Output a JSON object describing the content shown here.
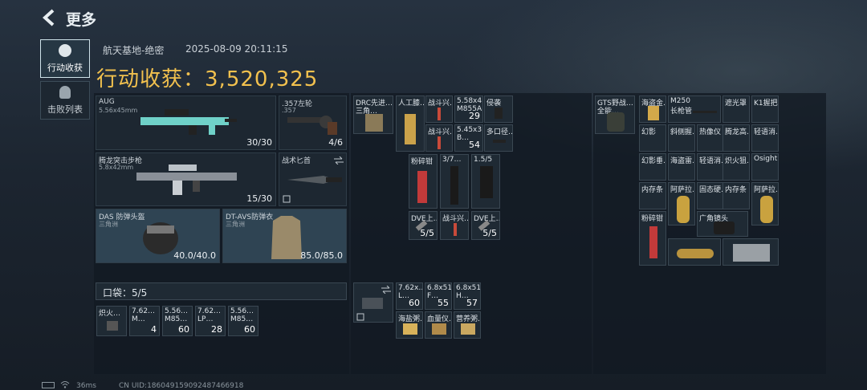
{
  "header": {
    "title": "更多",
    "back_icon": "back-arrow-icon"
  },
  "sidebar": {
    "tabs": [
      {
        "label": "行动收获",
        "icon": "harvest-icon"
      },
      {
        "label": "击败列表",
        "icon": "skull-icon"
      }
    ]
  },
  "match": {
    "map": "航天基地-绝密",
    "time": "2025-08-09 20:11:15"
  },
  "harvest": {
    "label": "行动收获：",
    "value": "3,520,325"
  },
  "weapons": {
    "primary1": {
      "name": "AUG",
      "sub": "5.56x45mm",
      "ammo": "30/30"
    },
    "pistol": {
      "name": ".357左轮",
      "sub": ".357",
      "ammo": "4/6"
    },
    "primary2": {
      "name": "腾龙突击步枪",
      "sub": "5.8x42mm",
      "ammo": "15/30"
    },
    "knife": {
      "name": "战术匕首"
    },
    "helmet": {
      "name": "DAS 防弹头盔",
      "sub": "三角洲",
      "dur": "40.0/40.0"
    },
    "armor": {
      "name": "DT-AVS防弹衣",
      "sub": "三角洲",
      "dur": "85.0/85.0"
    }
  },
  "pocket": {
    "label": "口袋：5/5",
    "items": [
      {
        "name": "炽火…",
        "count": ""
      },
      {
        "name": "7.62…",
        "sub": "M…",
        "count": "4"
      },
      {
        "name": "5.56…",
        "sub": "M85…",
        "count": "60"
      },
      {
        "name": "7.62…",
        "sub": "LP…",
        "count": "28"
      },
      {
        "name": "5.56…",
        "sub": "M85…",
        "count": "60"
      }
    ]
  },
  "rig": {
    "items": [
      {
        "name": "DRC先进…",
        "sub": "三角…"
      },
      {
        "name": "人工膝…"
      },
      {
        "name": "战斗兴…"
      },
      {
        "name": "5.58x4…",
        "sub": "M855A…",
        "count": "29"
      },
      {
        "name": "侵袭"
      },
      {
        "name": "战斗兴…"
      },
      {
        "name": "5.45x3…",
        "sub": "B…",
        "count": "54"
      },
      {
        "name": "多口径…"
      },
      {
        "name": "粉碎钳"
      },
      {
        "name": "3/7…"
      },
      {
        "name": "1.5/5"
      },
      {
        "name": "DVE上…",
        "count": "5/5"
      },
      {
        "name": "战斗兴…"
      },
      {
        "name": "DVE上…",
        "count": "5/5"
      }
    ]
  },
  "bag": {
    "items": [
      {
        "name": "7.62x…",
        "sub": "L…",
        "count": "60"
      },
      {
        "name": "6.8x51…",
        "sub": "F…",
        "count": "55"
      },
      {
        "name": "6.8x51…",
        "sub": "H…",
        "count": "57"
      },
      {
        "name": "海盐粥…"
      },
      {
        "name": "血量仪…"
      },
      {
        "name": "营养粥…"
      }
    ]
  },
  "backpack": {
    "name": "GTS野战…",
    "sub": "全能…",
    "items": [
      {
        "name": "海盗金…"
      },
      {
        "name": "M250",
        "sub": "长枪管"
      },
      {
        "name": "遮光罩"
      },
      {
        "name": "K1握把"
      },
      {
        "name": "幻影"
      },
      {
        "name": "斜侧握…"
      },
      {
        "name": "热像仪"
      },
      {
        "name": "腾龙高…"
      },
      {
        "name": "轻语消…"
      },
      {
        "name": "幻影垂…"
      },
      {
        "name": "海盗雷…"
      },
      {
        "name": "轻语消…"
      },
      {
        "name": "炽火狙…"
      },
      {
        "name": "Osight"
      },
      {
        "name": "内存条"
      },
      {
        "name": "阿萨拉…"
      },
      {
        "name": "固态硬…"
      },
      {
        "name": "内存条"
      },
      {
        "name": "阿萨拉…"
      },
      {
        "name": "粉碎钳"
      },
      {
        "name": "广角镜头"
      }
    ]
  },
  "status": {
    "ping": "36ms",
    "uid": "CN UID:18604915909248746691​8"
  }
}
